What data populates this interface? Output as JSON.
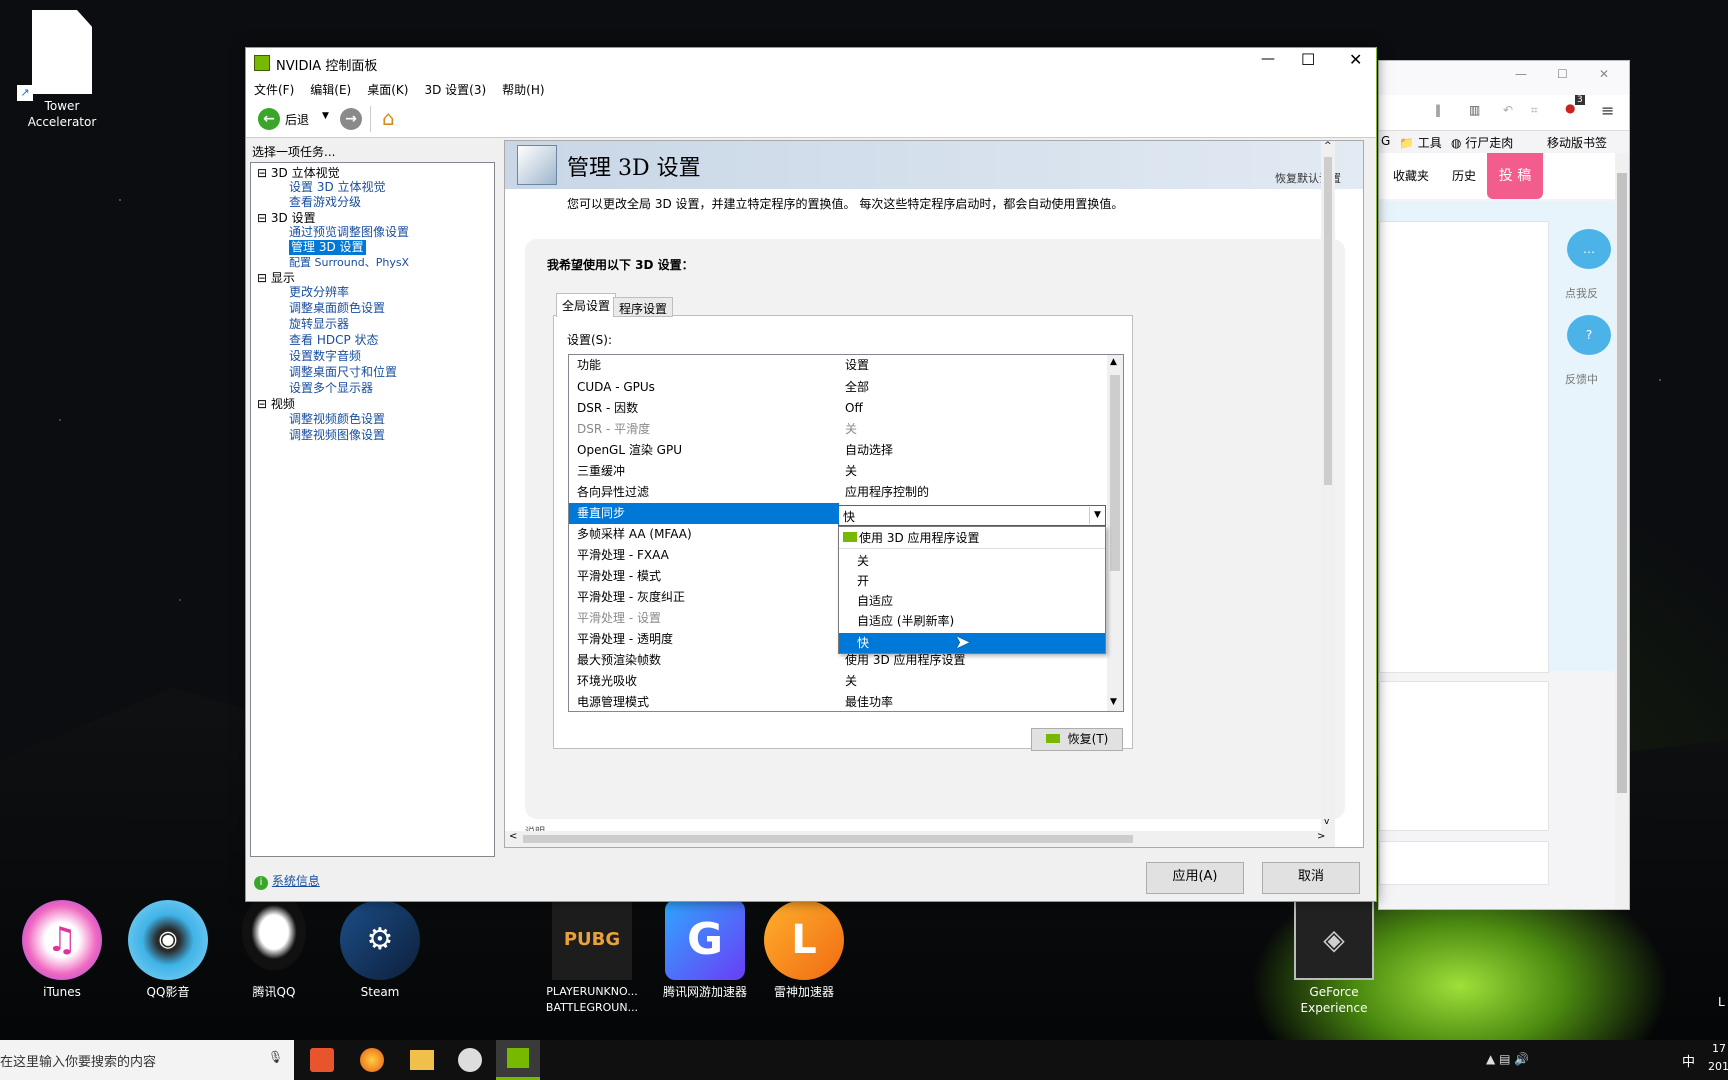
{
  "desktop": {
    "icons": [
      {
        "label": "Tower Accelerator",
        "icon": "file-icon"
      },
      {
        "label": "iTunes",
        "icon": "itunes-icon"
      },
      {
        "label": "QQ影音",
        "icon": "qqplayer-icon"
      },
      {
        "label": "腾讯QQ",
        "icon": "qq-icon"
      },
      {
        "label": "Steam",
        "icon": "steam-icon"
      },
      {
        "label": "PLAYERUNKNO... BATTLEGROUN...",
        "icon": "pubg-icon",
        "short": "PUBG"
      },
      {
        "label": "腾讯网游加速器",
        "icon": "tencent-accel-icon"
      },
      {
        "label": "雷神加速器",
        "icon": "leishen-icon"
      },
      {
        "label": "GeForce Experience",
        "icon": "geforce-icon"
      }
    ]
  },
  "browser": {
    "toolbar_items": [
      "工具",
      "行尸走肉",
      "移动版书签"
    ],
    "nav": [
      "收藏夹",
      "历史"
    ],
    "post_button": "投 稿",
    "side_labels": [
      "点我反",
      "反馈中"
    ],
    "badge": "3",
    "partial_text": "G"
  },
  "window": {
    "title": "NVIDIA 控制面板",
    "menu": [
      "文件(F)",
      "编辑(E)",
      "桌面(K)",
      "3D 设置(3)",
      "帮助(H)"
    ],
    "back_label": "后退",
    "task_prompt": "选择一项任务...",
    "tree": {
      "stereo": "3D 立体视觉",
      "stereo_items": [
        "设置 3D 立体视觉",
        "查看游戏分级"
      ],
      "settings3d": "3D 设置",
      "settings_items": [
        "通过预览调整图像设置",
        "管理 3D 设置",
        "配置 Surround、PhysX"
      ],
      "display": "显示",
      "display_items": [
        "更改分辨率",
        "调整桌面颜色设置",
        "旋转显示器",
        "查看 HDCP 状态",
        "设置数字音频",
        "调整桌面尺寸和位置",
        "设置多个显示器"
      ],
      "video": "视频",
      "video_items": [
        "调整视频颜色设置",
        "调整视频图像设置"
      ]
    },
    "page_title": "管理 3D 设置",
    "restore_defaults": "恢复默认设置",
    "description": "您可以更改全局 3D 设置，并建立特定程序的置换值。 每次这些特定程序启动时，都会自动使用置换值。",
    "section_heading": "我希望使用以下 3D 设置：",
    "tabs": [
      "全局设置",
      "程序设置"
    ],
    "settings_label": "设置(S):",
    "columns": [
      "功能",
      "设置"
    ],
    "rows": [
      {
        "feature": "CUDA - GPUs",
        "value": "全部"
      },
      {
        "feature": "DSR - 因数",
        "value": "Off"
      },
      {
        "feature": "DSR - 平滑度",
        "value": "关",
        "disabled": true
      },
      {
        "feature": "OpenGL 渲染 GPU",
        "value": "自动选择"
      },
      {
        "feature": "三重缓冲",
        "value": "关"
      },
      {
        "feature": "各向异性过滤",
        "value": "应用程序控制的"
      },
      {
        "feature": "垂直同步",
        "value": "快",
        "selected": true
      },
      {
        "feature": "多帧采样 AA (MFAA)",
        "value": ""
      },
      {
        "feature": "平滑处理 - FXAA",
        "value": ""
      },
      {
        "feature": "平滑处理 - 模式",
        "value": ""
      },
      {
        "feature": "平滑处理 - 灰度纠正",
        "value": ""
      },
      {
        "feature": "平滑处理 - 设置",
        "value": "",
        "disabled": true
      },
      {
        "feature": "平滑处理 - 透明度",
        "value": ""
      },
      {
        "feature": "最大预渲染帧数",
        "value": "使用 3D 应用程序设置"
      },
      {
        "feature": "环境光吸收",
        "value": "关"
      },
      {
        "feature": "电源管理模式",
        "value": "最佳功率"
      }
    ],
    "dropdown_options": [
      "使用 3D 应用程序设置",
      "关",
      "开",
      "自适应",
      "自适应 (半刷新率)",
      "快"
    ],
    "dropdown_selected": "快",
    "restore_button": "恢复(T)",
    "partial_label": "说明",
    "sysinfo": "系统信息",
    "apply": "应用(A)",
    "cancel": "取消"
  },
  "taskbar": {
    "search_placeholder": "在这里输入你要搜索的内容",
    "ime": "中",
    "clock": [
      "17",
      "201"
    ],
    "right_edge_label": "L"
  }
}
